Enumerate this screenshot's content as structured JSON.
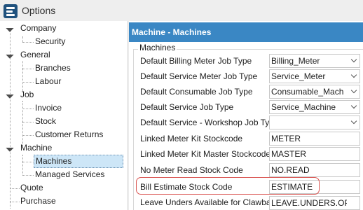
{
  "window": {
    "title": "Options"
  },
  "tree": {
    "company": "Company",
    "security": "Security",
    "general": "General",
    "branches": "Branches",
    "labour": "Labour",
    "job": "Job",
    "invoice": "Invoice",
    "stock": "Stock",
    "customer_returns": "Customer Returns",
    "machine": "Machine",
    "machines": "Machines",
    "managed_services": "Managed Services",
    "quote": "Quote",
    "purchase": "Purchase"
  },
  "panel": {
    "header": "Machine - Machines",
    "group": "Machines",
    "rows": [
      {
        "label": "Default Billing Meter Job Type",
        "value": "Billing_Meter",
        "type": "dropdown"
      },
      {
        "label": "Default Service Meter Job Type",
        "value": "Service_Meter",
        "type": "dropdown"
      },
      {
        "label": "Default Consumable Job Type",
        "value": "Consumable_Mach",
        "type": "dropdown"
      },
      {
        "label": "Default Service Job Type",
        "value": "Service_Machine",
        "type": "dropdown"
      },
      {
        "label": "Default Service - Workshop Job Type",
        "value": "",
        "type": "dropdown"
      },
      {
        "label": "Linked Meter Kit Stockcode",
        "value": "METER",
        "type": "text"
      },
      {
        "label": "Linked Meter Kit Master Stockcode",
        "value": "MASTER",
        "type": "text"
      },
      {
        "label": "No Meter Read Stock Code",
        "value": "NO.READ",
        "type": "text"
      },
      {
        "label": "Bill Estimate Stock Code",
        "value": "ESTIMATE",
        "type": "text"
      },
      {
        "label": "Leave Unders Available for Clawback",
        "value": "LEAVE.UNDERS.OPEN",
        "type": "text"
      }
    ]
  },
  "colors": {
    "header_bg": "#3a87c4",
    "highlight": "#d9534f",
    "selected_bg": "#cde6f7"
  },
  "icons": {
    "app": "app-logo-icon",
    "expander": "tree-expander-icon",
    "dropdown": "chevron-down-icon"
  }
}
